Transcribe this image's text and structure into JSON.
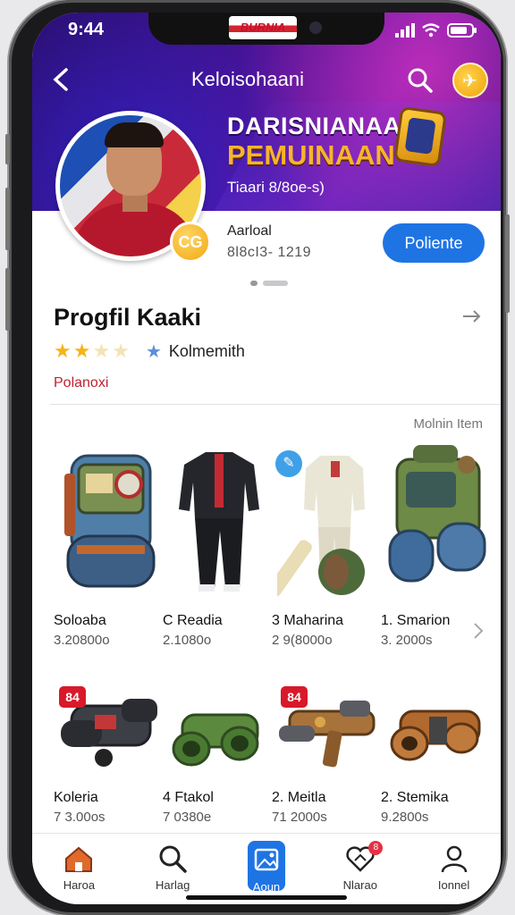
{
  "status_bar": {
    "time": "9:44",
    "brand": "BURNIA"
  },
  "header": {
    "title": "Keloisohaani",
    "banner_line1": "DARISNIANAAN",
    "banner_line2": "PEMUINAAN",
    "banner_sub": "Tiaari 8/8oe-s)"
  },
  "player": {
    "coin_label": "CG",
    "name": "Aarloal",
    "stats": "8l8cI3- 1219",
    "follow_label": "Poliente"
  },
  "profile": {
    "section_title": "Progfil Kaaki",
    "rating_stars": 2,
    "rating_max": 5,
    "level_label": "Kolmemith",
    "tagline": "Polanoxi",
    "more_items_label": "Molnin Item"
  },
  "items": [
    {
      "name": "Soloaba",
      "price": "3.20800o",
      "icon": "backpack-icon"
    },
    {
      "name": "C Readia",
      "price": "2.1080o",
      "icon": "tracksuit-icon"
    },
    {
      "name": "3 Maharina",
      "price": "2 9(8000o",
      "icon": "cricket-kit-icon",
      "badge": "chat"
    },
    {
      "name": "1. Smarion",
      "price": "3. 2000s",
      "icon": "armored-pack-icon"
    },
    {
      "name": "Koleria",
      "price": "7 3.00os",
      "icon": "heavy-cannon-icon",
      "tag": "84"
    },
    {
      "name": "4 Ftakol",
      "price": "7 0380e",
      "icon": "binoculars-icon"
    },
    {
      "name": "2. Meitla",
      "price": "71 2000s",
      "icon": "blaster-icon",
      "tag": "84"
    },
    {
      "name": "2. Stemika",
      "price": "9.2800s",
      "icon": "bronze-binoculars-icon"
    }
  ],
  "tabs": [
    {
      "label": "Haroa",
      "icon": "home-icon"
    },
    {
      "label": "Harlag",
      "icon": "search-icon"
    },
    {
      "label": "Aoun",
      "icon": "gallery-icon",
      "active": true
    },
    {
      "label": "Nlarao",
      "icon": "heart-icon",
      "badge": "8"
    },
    {
      "label": "Ionnel",
      "icon": "profile-icon"
    }
  ],
  "colors": {
    "accent": "#1f74e3",
    "banner": "#4b1293",
    "gold": "#f7b42c",
    "red": "#c0222e"
  }
}
